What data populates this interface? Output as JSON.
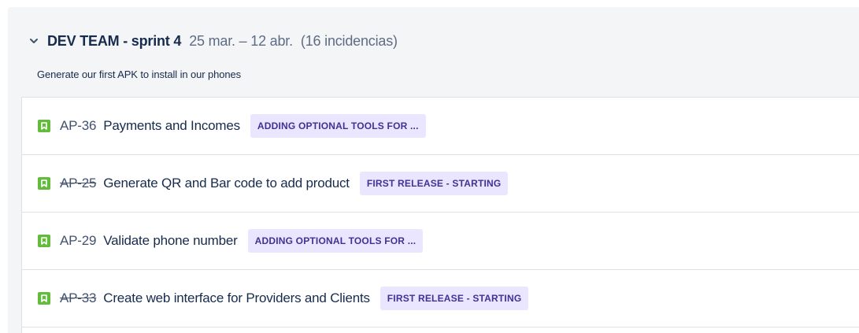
{
  "sprint": {
    "name": "DEV TEAM - sprint 4",
    "dates": "25 mar. – 12 abr.",
    "issue_count": "(16 incidencias)",
    "goal": "Generate our first APK to install in our phones"
  },
  "icons": {
    "collapse": "chevron-down-icon",
    "issue_type": "story-bookmark-icon"
  },
  "colors": {
    "story": "#63ba3c",
    "epic_bg": "#eae6ff",
    "epic_text": "#403294",
    "text_primary": "#172b4d",
    "text_secondary": "#5e6c84"
  },
  "issues": [
    {
      "key": "AP-36",
      "summary": "Payments and Incomes",
      "epic": "ADDING OPTIONAL TOOLS FOR ..."
    },
    {
      "key": "AP-25",
      "summary": "Generate QR and Bar code to add product",
      "epic": "FIRST RELEASE - STARTING"
    },
    {
      "key": "AP-29",
      "summary": "Validate phone number",
      "epic": "ADDING OPTIONAL TOOLS FOR ..."
    },
    {
      "key": "AP-33",
      "summary": "Create web interface for Providers and Clients",
      "epic": "FIRST RELEASE - STARTING"
    }
  ]
}
